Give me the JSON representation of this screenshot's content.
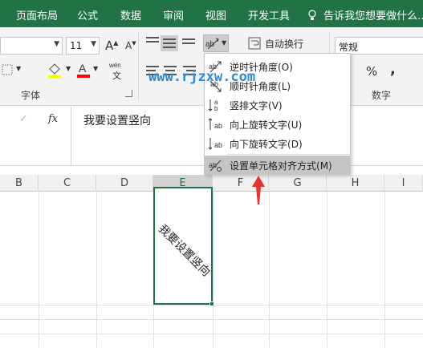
{
  "ribbon_tabs": [
    "页面布局",
    "公式",
    "数据",
    "审阅",
    "视图",
    "开发工具"
  ],
  "tell_me": "告诉我您想要做什么...",
  "font": {
    "size": "11",
    "grow_label": "A",
    "shrink_label": "A",
    "fill_color": "#ffff00",
    "font_color": "#ff0000",
    "group_label": "字体"
  },
  "alignment": {
    "wrap_text": "自动换行",
    "orientation_menu": [
      {
        "label": "逆时针角度",
        "key": "(O)"
      },
      {
        "label": "顺时针角度",
        "key": "(L)"
      },
      {
        "label": "竖排文字",
        "key": "(V)"
      },
      {
        "label": "向上旋转文字",
        "key": "(U)"
      },
      {
        "label": "向下旋转文字",
        "key": "(D)"
      },
      {
        "label": "设置单元格对齐方式",
        "key": "(M)"
      }
    ]
  },
  "number": {
    "format": "常规",
    "group_label": "数字",
    "percent": "%",
    "comma": ","
  },
  "watermark": "www.rjzxw.com",
  "formula_bar": {
    "cancel": "✓",
    "fx": "fx",
    "content": "我要设置竖向"
  },
  "columns": [
    "B",
    "C",
    "D",
    "E",
    "F",
    "G",
    "H",
    "I"
  ],
  "selected_column": "E",
  "cell_text": "我要设置竖向",
  "accent": "#217346",
  "highlight": "#c5c5c5",
  "arrow_color": "#e8322e"
}
